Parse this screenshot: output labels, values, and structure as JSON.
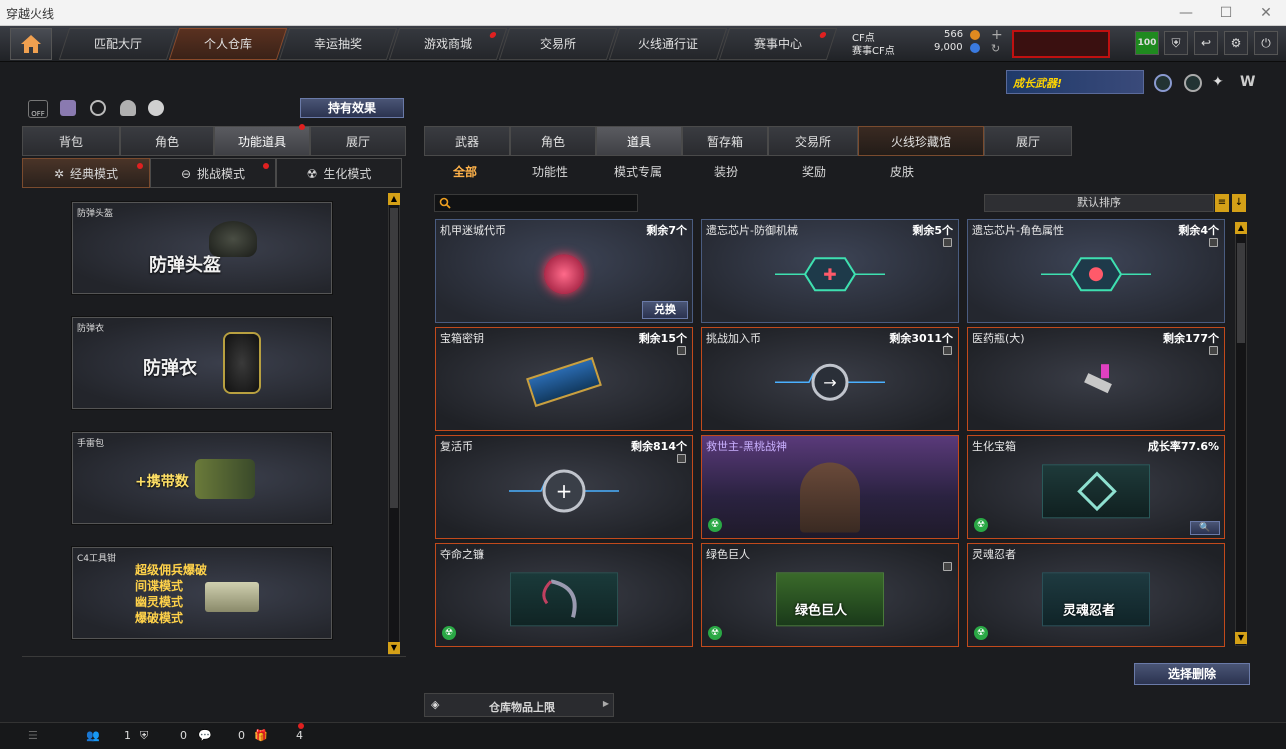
{
  "window": {
    "title": "穿越火线"
  },
  "nav": {
    "tabs": [
      "匹配大厅",
      "个人仓库",
      "幸运抽奖",
      "游戏商城",
      "交易所",
      "火线通行证",
      "赛事中心"
    ],
    "cf_label": "CF点",
    "cf_value": "566",
    "match_cf_label": "赛事CF点",
    "match_cf_value": "9,000",
    "badge_value": "100",
    "banner_text": "成长武器!"
  },
  "left": {
    "effects_button": "持有效果",
    "tabs": [
      "背包",
      "角色",
      "功能道具",
      "展厅"
    ],
    "modes": [
      "经典模式",
      "挑战模式",
      "生化模式"
    ],
    "cards": [
      {
        "label": "防弹头盔",
        "title": "防弹头盔"
      },
      {
        "label": "防弹衣",
        "title": "防弹衣"
      },
      {
        "label": "手雷包",
        "title": "+携带数"
      },
      {
        "label": "C4工具钳",
        "lines": [
          "超级佣兵爆破",
          "间谍模式",
          "幽灵模式",
          "爆破模式"
        ]
      }
    ]
  },
  "right": {
    "tabs": [
      "武器",
      "角色",
      "道具",
      "暂存箱",
      "交易所",
      "火线珍藏馆",
      "展厅"
    ],
    "subtabs": [
      "全部",
      "功能性",
      "模式专属",
      "装扮",
      "奖励",
      "皮肤"
    ],
    "search_placeholder": "",
    "sort_label": "默认排序",
    "items": [
      {
        "name": "机甲迷城代币",
        "count": "剩余7个",
        "button": "兑换"
      },
      {
        "name": "遗忘芯片-防御机械",
        "count": "剩余5个"
      },
      {
        "name": "遗忘芯片-角色属性",
        "count": "剩余4个"
      },
      {
        "name": "宝箱密钥",
        "count": "剩余15个"
      },
      {
        "name": "挑战加入币",
        "count": "剩余3011个"
      },
      {
        "name": "医药瓶(大)",
        "count": "剩余177个"
      },
      {
        "name": "复活币",
        "count": "剩余814个"
      },
      {
        "name": "救世主-黑桃战神",
        "count": ""
      },
      {
        "name": "生化宝箱",
        "count": "成长率77.6%"
      },
      {
        "name": "夺命之镰",
        "count": ""
      },
      {
        "name": "绿色巨人",
        "count": "",
        "art_text": "绿色巨人"
      },
      {
        "name": "灵魂忍者",
        "count": "",
        "art_text": "灵魂忍者"
      }
    ],
    "delete_button": "选择删除",
    "limit_label": "仓库物品上限"
  },
  "bottom": {
    "v1": "1",
    "v2": "0",
    "v3": "0",
    "v4": "4"
  }
}
